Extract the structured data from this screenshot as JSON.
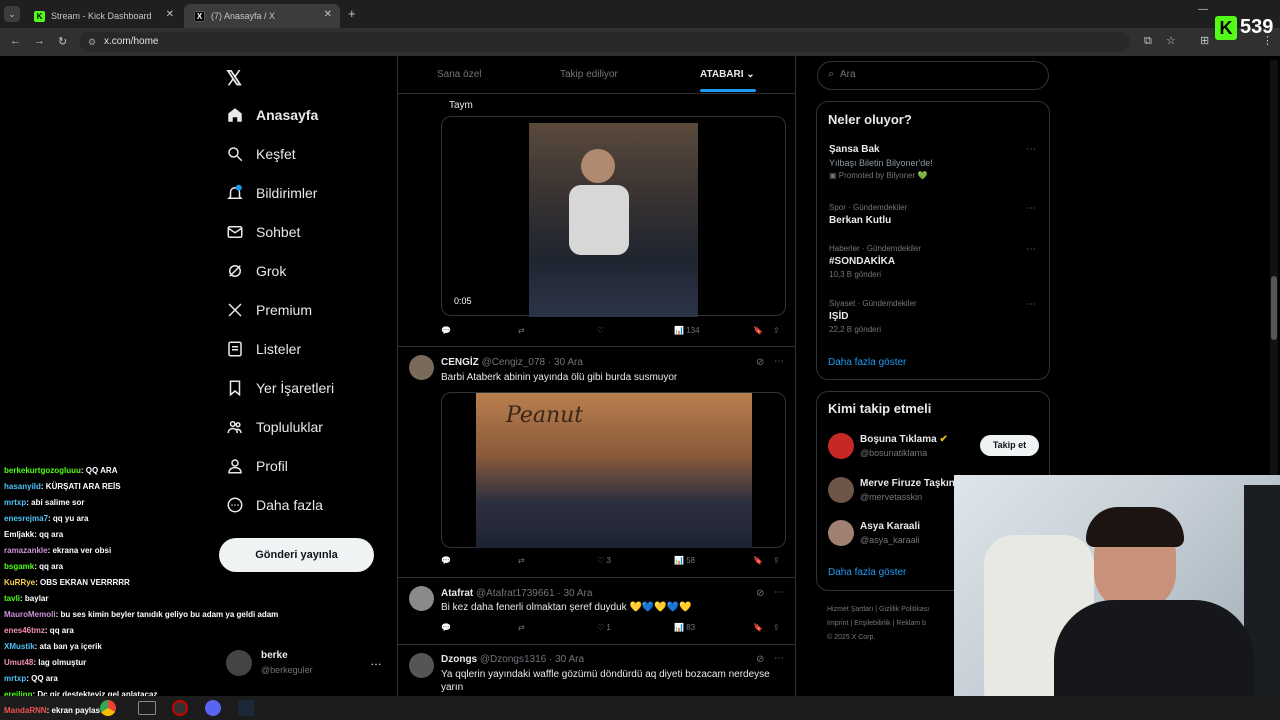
{
  "browser": {
    "tabs": [
      {
        "label": "Stream - Kick Dashboard",
        "active": false
      },
      {
        "label": "(7) Anasayfa / X",
        "active": true
      }
    ],
    "url": "x.com/home",
    "kick_viewer_count": "539"
  },
  "sidebar": {
    "items": [
      {
        "label": "Anasayfa",
        "icon": "home-icon"
      },
      {
        "label": "Keşfet",
        "icon": "search-icon"
      },
      {
        "label": "Bildirimler",
        "icon": "bell-icon"
      },
      {
        "label": "Sohbet",
        "icon": "mail-icon"
      },
      {
        "label": "Grok",
        "icon": "grok-icon"
      },
      {
        "label": "Premium",
        "icon": "x-icon"
      },
      {
        "label": "Listeler",
        "icon": "list-icon"
      },
      {
        "label": "Yer İşaretleri",
        "icon": "bookmark-icon"
      },
      {
        "label": "Topluluklar",
        "icon": "people-icon"
      },
      {
        "label": "Profil",
        "icon": "person-icon"
      },
      {
        "label": "Daha fazla",
        "icon": "more-icon"
      }
    ],
    "post_button": "Gönderi yayınla",
    "account": {
      "name": "berke",
      "handle": "@berkeguler"
    }
  },
  "feed": {
    "tabs": [
      "Sana özel",
      "Takip ediliyor",
      "ATABARI"
    ],
    "active_tab": "ATABARI",
    "tweets": [
      {
        "text": "Taym",
        "video_time": "0:05",
        "views": "134"
      },
      {
        "name": "CENGİZ",
        "handle": "@Cengiz_078",
        "date": "30 Ara",
        "text": "Barbi Ataberk abinin yayında ölü gibi burda susmuyor",
        "likes": "3",
        "views": "58"
      },
      {
        "name": "Atafrat",
        "handle": "@Atafrat1739661",
        "date": "30 Ara",
        "text": "Bi kez daha fenerli olmaktan şeref duyduk 💛💙💛💙💛",
        "likes": "1",
        "views": "83"
      },
      {
        "name": "Dzongs",
        "handle": "@Dzongs1316",
        "date": "30 Ara",
        "text": "Ya qqlerin yayındaki waffle gözümü döndürdü aq diyeti bozacam nerdeyse yarın"
      }
    ]
  },
  "right": {
    "search_placeholder": "Ara",
    "whats_happening": {
      "title": "Neler oluyor?",
      "trends": [
        {
          "cat": "",
          "name": "Şansa Bak",
          "sub": "Yılbaşı Biletin Bilyoner'de!",
          "promo": "Promoted by Bilyoner 💚"
        },
        {
          "cat": "Spor · Gündemdekiler",
          "name": "Berkan Kutlu",
          "sub": ""
        },
        {
          "cat": "Haberler · Gündemdekiler",
          "name": "#SONDAKİKA",
          "sub": "10,3 B gönderi"
        },
        {
          "cat": "Siyaset · Gündemdekiler",
          "name": "IŞİD",
          "sub": "22,2 B gönderi"
        }
      ],
      "show_more": "Daha fazla göster"
    },
    "who_to_follow": {
      "title": "Kimi takip etmeli",
      "users": [
        {
          "name": "Boşuna Tıklama",
          "handle": "@bosunatiklama"
        },
        {
          "name": "Merve Firuze Taşkın",
          "handle": "@mervetasskin"
        },
        {
          "name": "Asya Karaali",
          "handle": "@asya_karaali"
        }
      ],
      "follow_button": "Takip et",
      "show_more": "Daha fazla göster"
    },
    "footer": [
      "Hizmet Şartları",
      "Gizlilik Politikası",
      "Imprint",
      "Erişilebilirlik",
      "Reklam b",
      "© 2025 X Corp."
    ]
  },
  "chat": [
    {
      "user": "berkekurtgozogluuu",
      "msg": ": QQ ARA",
      "color": "#53fc18"
    },
    {
      "user": "hasanyild",
      "msg": ": KÜRŞATI ARA REİS",
      "color": "#4fc3f7"
    },
    {
      "user": "mrtxp",
      "msg": ": abi salime sor",
      "color": "#4fc3f7"
    },
    {
      "user": "enesrejma7",
      "msg": ": qq yu ara",
      "color": "#4fc3f7"
    },
    {
      "user": "Emljakk",
      "msg": ": qq ara",
      "color": "#ffffff"
    },
    {
      "user": "ramazankle",
      "msg": ": ekrana ver obsi",
      "color": "#ce93d8"
    },
    {
      "user": "bsgamk",
      "msg": ": qq ara",
      "color": "#53fc18"
    },
    {
      "user": "KuRRye",
      "msg": ": OBS EKRAN VERRRRR",
      "color": "#ffd54f"
    },
    {
      "user": "tavli",
      "msg": ": baylar",
      "color": "#53fc18"
    },
    {
      "user": "MauroMemoli",
      "msg": ": bu ses kimin beyler tanıdık geliyo bu adam ya geldi adam",
      "color": "#ce93d8"
    },
    {
      "user": "enes46tmz",
      "msg": ": qq ara",
      "color": "#f48fb1"
    },
    {
      "user": "XMustik",
      "msg": ": ata ban ya içerik",
      "color": "#4fc3f7"
    },
    {
      "user": "Umut48",
      "msg": ": lag olmuştur",
      "color": "#f48fb1"
    },
    {
      "user": "mrtxp",
      "msg": ": QQ ara",
      "color": "#4fc3f7"
    },
    {
      "user": "ereilinn",
      "msg": ": Dc gir destekteyiz gel anlatacaz",
      "color": "#53fc18"
    },
    {
      "user": "MandaRNN",
      "msg": ": ekran paylas",
      "color": "#ef5350"
    }
  ]
}
